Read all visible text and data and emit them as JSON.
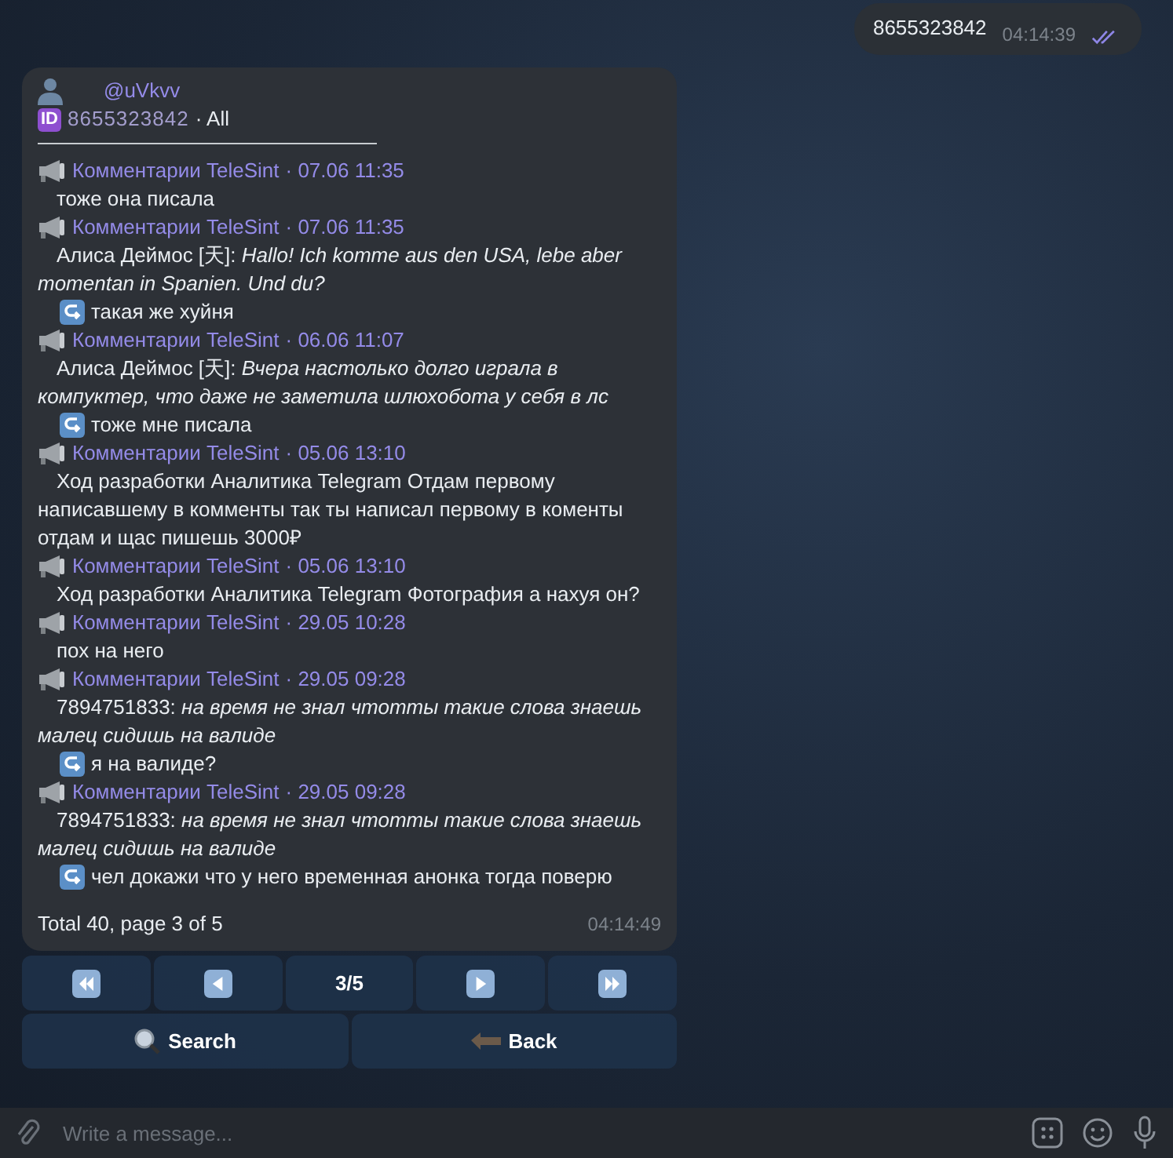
{
  "outgoing": {
    "text": "8655323842",
    "time": "04:14:39",
    "read": true
  },
  "bot_message": {
    "user": "@uVkvv",
    "id_badge": "ID",
    "user_id": "8655323842",
    "filter": "· All",
    "entries": [
      {
        "source": "Комментарии TeleSint",
        "date": "· 07.06 11:35",
        "kind": "plain",
        "text": "тоже она писала"
      },
      {
        "source": "Комментарии TeleSint",
        "date": "· 07.06 11:35",
        "kind": "quote",
        "author": "Алиса Деймос [天]:",
        "text": "Hallo!  Ich komme aus den USA, lebe aber momentan in Spanien. Und du?",
        "reply": "такая же хуйня"
      },
      {
        "source": "Комментарии TeleSint",
        "date": "· 06.06 11:07",
        "kind": "quote",
        "author": "Алиса Деймос [天]:",
        "text": "Вчера настолько долго играла в компуктер, что даже не заметила шлюхобота у себя в лс",
        "reply": "тоже мне писала"
      },
      {
        "source": "Комментарии TeleSint",
        "date": "· 05.06 13:10",
        "kind": "plain",
        "text": "Ход разработки Аналитика Telegram Отдам первому написавшему в комменты так ты написал первому в коменты отдам и щас пишешь 3000₽"
      },
      {
        "source": "Комментарии TeleSint",
        "date": "· 05.06 13:10",
        "kind": "plain",
        "text": "Ход разработки Аналитика Telegram Фотография а нахуя он?"
      },
      {
        "source": "Комментарии TeleSint",
        "date": "· 29.05 10:28",
        "kind": "plain",
        "text": "пох на него"
      },
      {
        "source": "Комментарии TeleSint",
        "date": "· 29.05 09:28",
        "kind": "quote",
        "author": "7894751833:",
        "text": "на время не знал чтотты такие слова знаешь малец сидишь на валиде",
        "reply": "я на валиде?"
      },
      {
        "source": "Комментарии TeleSint",
        "date": "· 29.05 09:28",
        "kind": "quote",
        "author": "7894751833:",
        "text": "на время не знал чтотты такие слова знаешь малец сидишь на валиде",
        "reply": "чел докажи что у него временная анонка тогда поверю"
      }
    ],
    "footer": "Total 40, page 3 of 5",
    "time": "04:14:49"
  },
  "keyboard": [
    [
      {
        "kind": "first"
      },
      {
        "kind": "prev"
      },
      {
        "kind": "label",
        "label": "3/5"
      },
      {
        "kind": "next"
      },
      {
        "kind": "last"
      }
    ],
    [
      {
        "kind": "search",
        "label": "Search"
      },
      {
        "kind": "back",
        "label": "Back"
      }
    ]
  ],
  "composer": {
    "placeholder": "Write a message..."
  }
}
